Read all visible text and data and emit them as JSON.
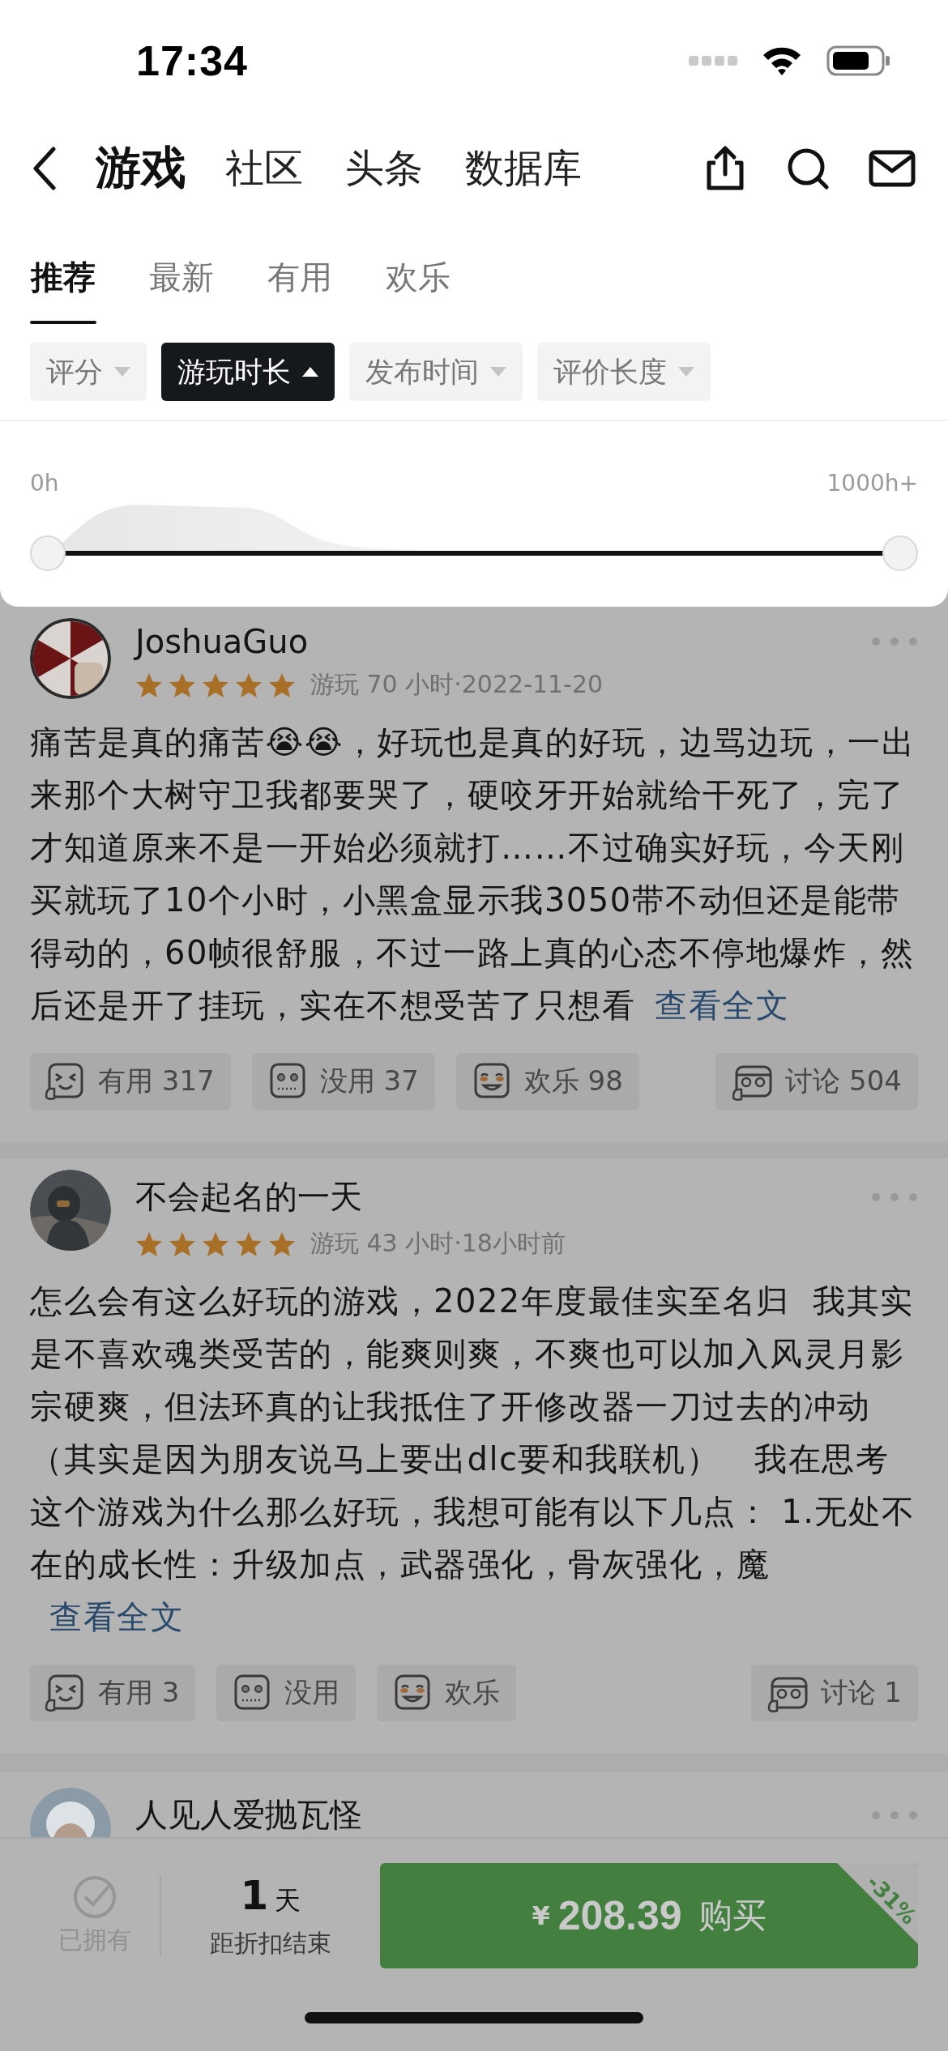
{
  "status_bar": {
    "time": "17:34"
  },
  "nav": {
    "title": "游戏",
    "links": [
      {
        "label": "社区"
      },
      {
        "label": "头条"
      },
      {
        "label": "数据库"
      }
    ]
  },
  "tabs": [
    {
      "label": "推荐",
      "selected": true
    },
    {
      "label": "最新",
      "selected": false
    },
    {
      "label": "有用",
      "selected": false
    },
    {
      "label": "欢乐",
      "selected": false
    }
  ],
  "filters": [
    {
      "label": "评分",
      "selected": false
    },
    {
      "label": "游玩时长",
      "selected": true
    },
    {
      "label": "发布时间",
      "selected": false
    },
    {
      "label": "评价长度",
      "selected": false
    }
  ],
  "playtime_slider": {
    "min_label": "0h",
    "max_label": "1000h+",
    "thumbs": [
      {
        "level": 0
      },
      {
        "level": 1
      }
    ]
  },
  "reviews": [
    {
      "author": "JoshuaGuo",
      "stars": 5,
      "meta": "游玩 70 小时·2022-11-20",
      "body": "痛苦是真的痛苦😭😭，好玩也是真的好玩，边骂边玩，一出来那个大树守卫我都要哭了，硬咬牙开始就给干死了，完了才知道原来不是一开始必须就打……不过确实好玩，今天刚买就玩了10个小时，小黑盒显示我3050带不动但还是能带得动的，60帧很舒服，不过一路上真的心态不停地爆炸，然后还是开了挂玩，实在不想受苦了只想看",
      "more_link": "查看全文",
      "reactions": [
        {
          "kind": "useful",
          "label": "有用",
          "count": "317"
        },
        {
          "kind": "useless",
          "label": "没用",
          "count": "37"
        },
        {
          "kind": "funny",
          "label": "欢乐",
          "count": "98"
        }
      ],
      "discussion": {
        "label": "讨论",
        "count": "504"
      }
    },
    {
      "author": "不会起名的一天",
      "stars": 5,
      "meta": "游玩 43 小时·18小时前",
      "body": "怎么会有这么好玩的游戏，2022年度最佳实至名归  我其实是不喜欢魂类受苦的，能爽则爽，不爽也可以加入风灵月影宗硬爽，但法环真的让我抵住了开修改器一刀过去的冲动（其实是因为朋友说马上要出dlc要和我联机）   我在思考这个游戏为什么那么好玩，我想可能有以下几点： 1.无处不在的成长性：升级加点，武器强化，骨灰强化，魔",
      "more_link": "查看全文",
      "reactions": [
        {
          "kind": "useful",
          "label": "有用",
          "count": "3"
        },
        {
          "kind": "useless",
          "label": "没用"
        },
        {
          "kind": "funny",
          "label": "欢乐"
        }
      ],
      "discussion": {
        "label": "讨论",
        "count": "1"
      }
    },
    {
      "author": "人见人爱抛瓦怪"
    }
  ],
  "purchase": {
    "owned_label": "已拥有",
    "countdown_value": "1",
    "countdown_unit": "天",
    "countdown_label": "距折扣结束",
    "currency": "¥",
    "price": "208.39",
    "action": "购买",
    "discount": "-31%"
  }
}
